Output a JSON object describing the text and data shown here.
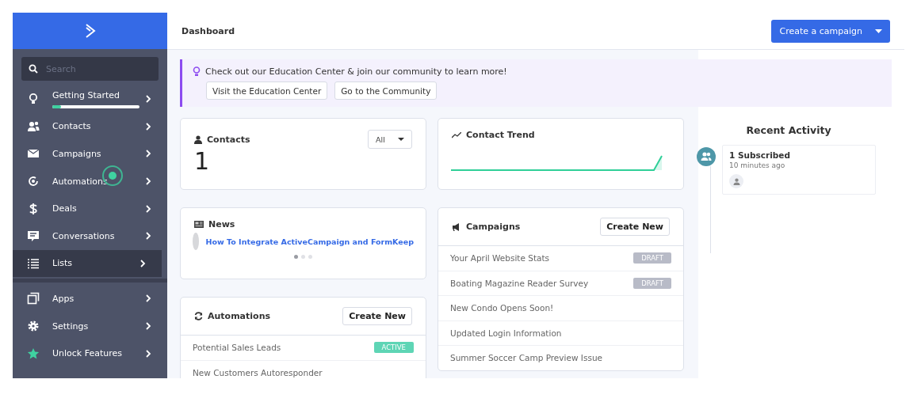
{
  "sidebar": {
    "search": {
      "placeholder": "Search"
    },
    "items": [
      {
        "kind": "bulb",
        "label": "Getting Started",
        "selected": false,
        "level": 0.1
      },
      {
        "kind": "contacts",
        "label": "Contacts",
        "selected": false
      },
      {
        "kind": "mail",
        "label": "Campaigns",
        "selected": false
      },
      {
        "kind": "automation",
        "label": "Automations",
        "selected": false,
        "hotspot": true
      },
      {
        "kind": "dollar",
        "label": "Deals",
        "selected": false
      },
      {
        "kind": "chat",
        "label": "Conversations",
        "selected": false
      },
      {
        "kind": "list",
        "label": "Lists",
        "selected": true
      }
    ],
    "bottom_items": [
      {
        "kind": "apps",
        "label": "Apps",
        "selected": false
      },
      {
        "kind": "gear",
        "label": "Settings",
        "selected": false
      },
      {
        "kind": "star",
        "label": "Unlock Features",
        "selected": false
      }
    ]
  },
  "header": {
    "title": "Dashboard",
    "primary_button": "Create a campaign"
  },
  "banner": {
    "text": "Check out our Education Center & join our community to learn more!",
    "buttons": [
      "Visit the Education Center",
      "Go to the Community"
    ]
  },
  "contacts_card": {
    "title": "Contacts",
    "filter": "All",
    "count": "1"
  },
  "trend_card": {
    "title": "Contact Trend"
  },
  "news_card": {
    "title": "News",
    "link": "How To Integrate ActiveCampaign and FormKeep",
    "pages": [
      {
        "selected": true
      },
      {
        "selected": false
      },
      {
        "selected": false
      }
    ]
  },
  "automations_card": {
    "title": "Automations",
    "button": "Create New",
    "rows": [
      {
        "name": "Potential Sales Leads",
        "status": "ACTIVE",
        "kind": "active"
      },
      {
        "name": "New Customers Autoresponder"
      }
    ]
  },
  "campaigns_card": {
    "title": "Campaigns",
    "button": "Create New",
    "rows": [
      {
        "name": "Your April Website Stats",
        "status": "DRAFT",
        "kind": "draft"
      },
      {
        "name": "Boating Magazine Reader Survey",
        "status": "DRAFT",
        "kind": "draft"
      },
      {
        "name": "New Condo Opens Soon!"
      },
      {
        "name": "Updated Login Information"
      },
      {
        "name": "Summer Soccer Camp Preview Issue"
      }
    ]
  },
  "recent_activity": {
    "title": "Recent Activity",
    "items": [
      {
        "title": "1 Subscribed",
        "time": "10 minutes ago"
      }
    ]
  }
}
